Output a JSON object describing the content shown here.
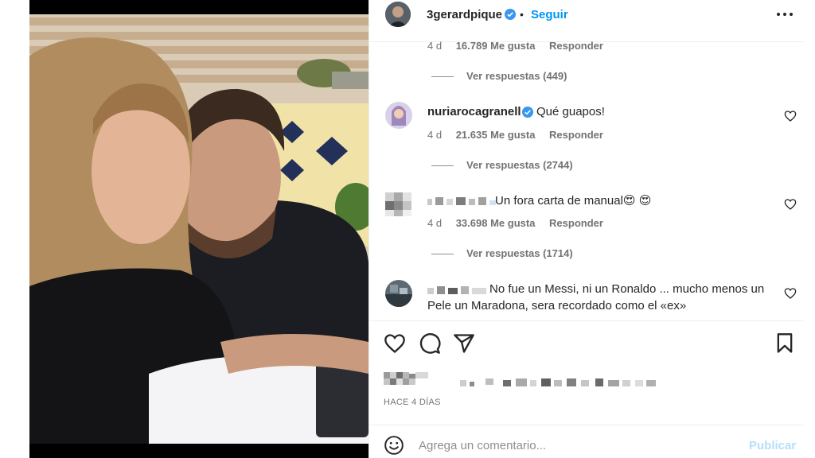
{
  "post": {
    "username": "3gerardpique",
    "dot": "•",
    "follow_label": "Seguir",
    "more_icon": "more-horizontal-icon"
  },
  "comments": [
    {
      "text": "",
      "age": "4 d",
      "likes": "16.789 Me gusta",
      "reply_label": "Responder",
      "view_replies": "Ver respuestas (449)"
    },
    {
      "user": "nuriarocagranell",
      "text": "Qué guapos!",
      "age": "4 d",
      "likes": "21.635 Me gusta",
      "reply_label": "Responder",
      "view_replies": "Ver respuestas (2744)"
    },
    {
      "text": "Un fora carta de manual😍 😍",
      "age": "4 d",
      "likes": "33.698 Me gusta",
      "reply_label": "Responder",
      "view_replies": "Ver respuestas (1714)"
    },
    {
      "text": "No fue un Messi, ni un Ronaldo ... mucho menos un",
      "text2": "Pele un Maradona, sera recordado como el «ex»"
    }
  ],
  "footer": {
    "posted": "HACE 4 DÍAS",
    "add_comment_placeholder": "Agrega un comentario...",
    "publish_label": "Publicar"
  },
  "colors": {
    "accent": "#0095f6",
    "publish_disabled": "#b2dffc",
    "verified": "#3897f0"
  }
}
